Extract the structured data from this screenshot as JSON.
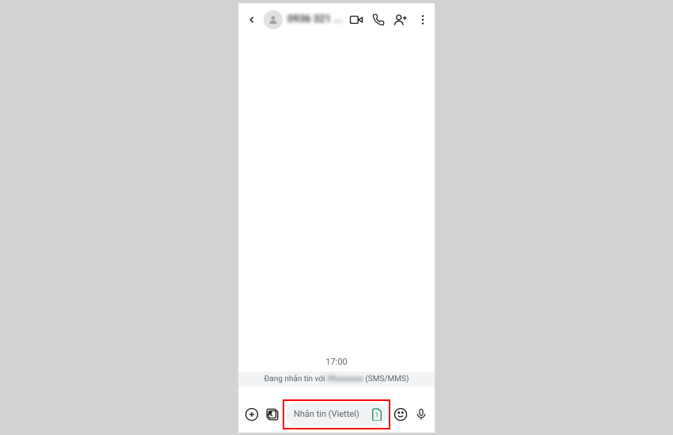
{
  "header": {
    "contact_name": "0936 321 ...",
    "icons": {
      "back": "back-icon",
      "avatar": "person-icon",
      "video": "video-icon",
      "call": "phone-icon",
      "add_person": "add-person-icon",
      "more": "more-icon"
    }
  },
  "conversation": {
    "timestamp": "17:00",
    "info_banner_prefix": "Đang nhắn tin với ",
    "info_banner_blurred": "09xxxxxxx",
    "info_banner_suffix": " (SMS/MMS)"
  },
  "composer": {
    "placeholder": "Nhắn tin (Viettel)",
    "sim_label": "1",
    "icons": {
      "add": "plus-icon",
      "gallery": "gallery-icon",
      "sim": "sim-icon",
      "emoji": "emoji-icon",
      "mic": "mic-icon"
    }
  }
}
